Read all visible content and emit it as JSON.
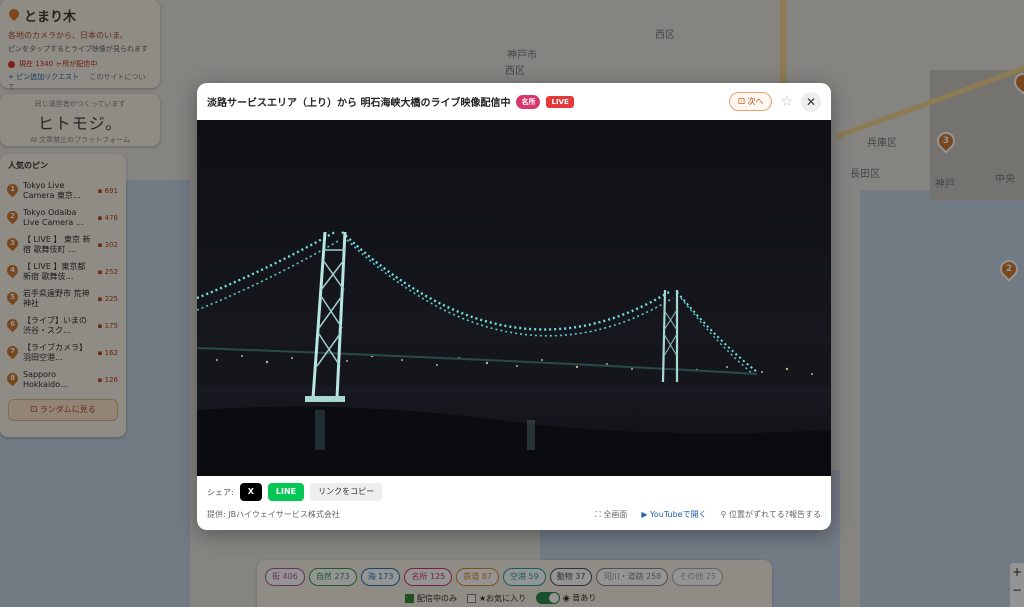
{
  "brand": {
    "name": "とまり木",
    "tagline1": "各地のカメラから、日本のいま。",
    "tagline2": "ピンをタップするとライブ映像が見られます",
    "live_status": "現在 1340 ヶ所が配信中",
    "add_pin": "+ ピン追加リクエスト",
    "about": "このサイトについて"
  },
  "hitomoji": {
    "small": "同じ運営者がつくっています",
    "logo": "ヒトモジ。",
    "sub": "AI 文章禁止のプラットフォーム"
  },
  "popular": {
    "title": "人気のピン",
    "items": [
      {
        "rank": "1",
        "name": "Tokyo Live Camera 東京…",
        "count": "691"
      },
      {
        "rank": "2",
        "name": "Tokyo Odaiba Live Camera …",
        "count": "478"
      },
      {
        "rank": "3",
        "name": "【 LIVE 】 東京 新宿 歌舞伎町 …",
        "count": "302"
      },
      {
        "rank": "4",
        "name": "【 LIVE 】東京都 新宿 歌舞伎…",
        "count": "252"
      },
      {
        "rank": "5",
        "name": "岩手県遠野市 荒神神社",
        "count": "225"
      },
      {
        "rank": "6",
        "name": "【ライブ】いまの渋谷・スク…",
        "count": "175"
      },
      {
        "rank": "7",
        "name": "【ライブカメラ】羽田空港…",
        "count": "162"
      },
      {
        "rank": "8",
        "name": "Sapporo Hokkaido…",
        "count": "126"
      }
    ],
    "random_label": "ランダムに見る"
  },
  "modal": {
    "title": "淡路サービスエリア（上り）から 明石海峡大橋のライブ映像配信中",
    "badge_meisho": "名所",
    "badge_live": "LIVE",
    "next_label": "次へ",
    "share_label": "シェア:",
    "share_x": "X",
    "share_line": "LINE",
    "copy_link": "リンクをコピー",
    "provider": "提供: JBハイウェイサービス株式会社",
    "fullscreen": "全画面",
    "youtube": "YouTubeで開く",
    "report": "位置がずれてる?報告する"
  },
  "filters": {
    "chips": [
      {
        "label": "街 406",
        "color": "#b05a9a"
      },
      {
        "label": "自然 273",
        "color": "#3a9a4a"
      },
      {
        "label": "海 173",
        "color": "#2a7ab0"
      },
      {
        "label": "名所 125",
        "color": "#d03a6a"
      },
      {
        "label": "鉄道 87",
        "color": "#e08a30"
      },
      {
        "label": "空港 59",
        "color": "#2aa0a0"
      },
      {
        "label": "動物 37",
        "color": "#555555"
      },
      {
        "label": "河川・道路 258",
        "color": "#888888"
      },
      {
        "label": "その他 25",
        "color": "#aaaaaa"
      }
    ],
    "live_only": "配信中のみ",
    "favorites": "★お気に入り",
    "sound": "音あり"
  },
  "map_labels": [
    "西区",
    "神戸市",
    "西区",
    "兵庫区",
    "長田区",
    "神戸",
    "中央"
  ],
  "colors": {
    "accent": "#e07a2e",
    "live": "#e53a3a",
    "meisho": "#d8356b",
    "line": "#06c755"
  }
}
